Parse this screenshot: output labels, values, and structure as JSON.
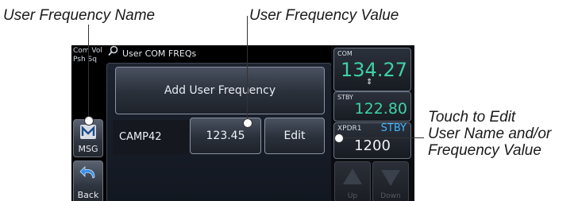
{
  "annotations": {
    "user_frequency_name": "User Frequency Name",
    "user_frequency_value": "User Frequency Value",
    "touch_to_edit_line1": "Touch to Edit",
    "touch_to_edit_line2": "User Name and/or",
    "touch_to_edit_line3": "Frequency Value"
  },
  "left_panel": {
    "com_vol_line1": "Com Vol",
    "com_vol_line2": "Psh Sq",
    "msg_label": "MSG",
    "back_label": "Back",
    "msg_icon": "msg-icon",
    "back_icon": "back-arrow-icon"
  },
  "page": {
    "title": "User COM FREQs",
    "add_button_label": "Add User Frequency",
    "entries": [
      {
        "name": "CAMP42",
        "frequency": "123.45",
        "edit_label": "Edit"
      }
    ]
  },
  "radio": {
    "com_label": "COM",
    "com_active": "134.27",
    "swap_icon": "swap-arrows-icon",
    "stby_label": "STBY",
    "com_standby": "122.80",
    "xpdr_label": "XPDR1",
    "xpdr_mode": "STBY",
    "xpdr_code": "1200",
    "up_label": "Up",
    "down_label": "Down"
  },
  "colors": {
    "frequency_green": "#3fd1a6",
    "xpdr_mode_blue": "#41b6ff"
  }
}
